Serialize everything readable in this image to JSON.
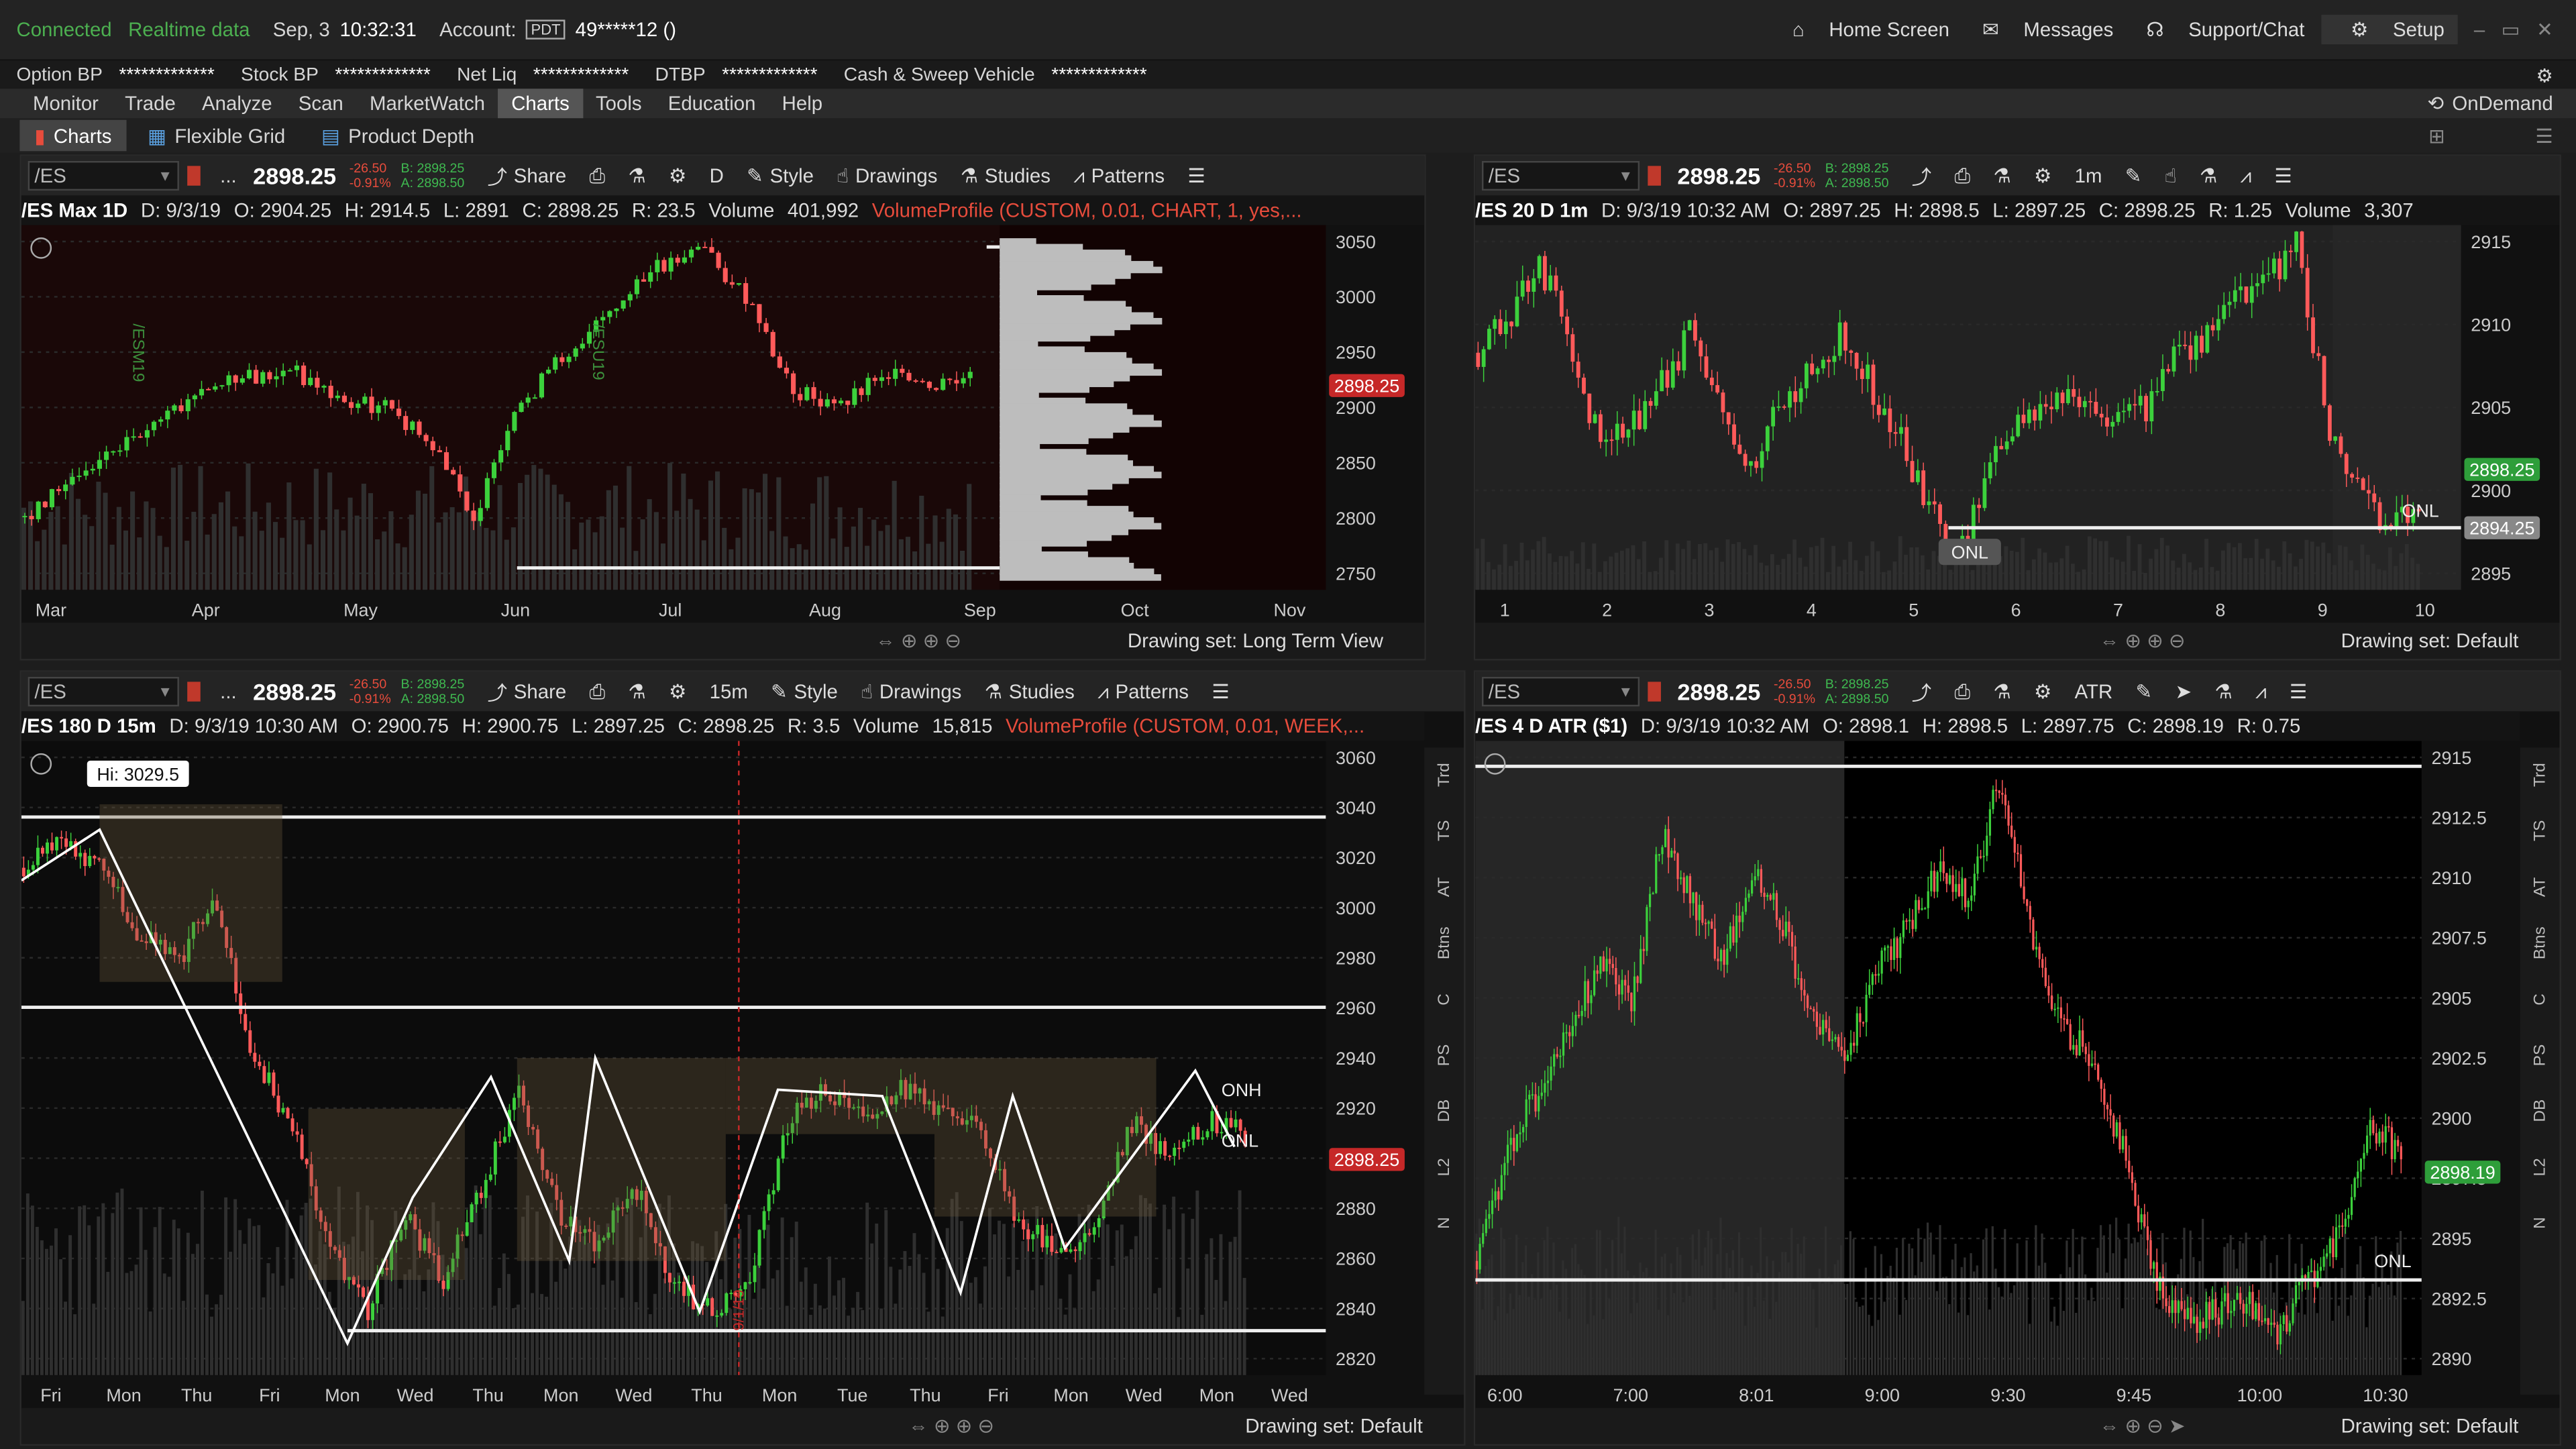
{
  "status": {
    "connected": "Connected",
    "realtime": "Realtime data",
    "date": "Sep, 3",
    "time": "10:32:31",
    "account_label": "Account:",
    "account_tag": "PDT",
    "account_value": "49*****12 ()"
  },
  "topnav": {
    "home": "Home Screen",
    "messages": "Messages",
    "support": "Support/Chat",
    "setup": "Setup"
  },
  "balances": {
    "option_bp": "Option BP",
    "option_bp_val": "*************",
    "stock_bp": "Stock BP",
    "stock_bp_val": "*************",
    "net_liq": "Net Liq",
    "net_liq_val": "*************",
    "dtbp": "DTBP",
    "dtbp_val": "*************",
    "cash": "Cash & Sweep Vehicle",
    "cash_val": "*************"
  },
  "menu": [
    "Monitor",
    "Trade",
    "Analyze",
    "Scan",
    "MarketWatch",
    "Charts",
    "Tools",
    "Education",
    "Help"
  ],
  "ondemand": "OnDemand",
  "subtabs": [
    "Charts",
    "Flexible Grid",
    "Product Depth"
  ],
  "common": {
    "symbol": "/ES",
    "price": "2898.25",
    "chg1": "-26.50",
    "chg2": "-0.91%",
    "bid": "B: 2898.25",
    "ask": "A: 2898.50",
    "share": "Share",
    "style": "Style",
    "drawings": "Drawings",
    "studies": "Studies",
    "patterns": "Patterns",
    "dots": "...",
    "onl": "ONL",
    "onh": "ONH"
  },
  "tl": {
    "agg": "D",
    "info": [
      "/ES Max 1D",
      "D: 9/3/19",
      "O: 2904.25",
      "H: 2914.5",
      "L: 2891",
      "C: 2898.25",
      "R: 23.5",
      "Volume",
      "401,992"
    ],
    "study": "VolumeProfile (CUSTOM, 0.01, CHART, 1, yes,...",
    "footer": "Drawing set: Long Term View",
    "yticks": [
      "3050",
      "3000",
      "2950",
      "2900",
      "2850",
      "2800",
      "2750"
    ],
    "xticks": [
      "Mar",
      "Apr",
      "May",
      "Jun",
      "Jul",
      "Aug",
      "Sep",
      "Oct",
      "Nov"
    ],
    "price_tag": "2898.25",
    "contract1": "/ESM19",
    "contract2": "/ESU19"
  },
  "tr": {
    "agg": "1m",
    "info": [
      "/ES 20 D 1m",
      "D: 9/3/19 10:32 AM",
      "O: 2897.25",
      "H: 2898.5",
      "L: 2897.25",
      "C: 2898.25",
      "R: 1.25",
      "Volume",
      "3,307"
    ],
    "footer": "Drawing set: Default",
    "yticks": [
      "2915",
      "2910",
      "2905",
      "2900",
      "2895"
    ],
    "xticks": [
      "1",
      "2",
      "3",
      "4",
      "5",
      "6",
      "7",
      "8",
      "9",
      "10"
    ],
    "price_tag": "2898.25",
    "onl_tag": "2894.25"
  },
  "bl": {
    "agg": "15m",
    "info": [
      "/ES 180 D 15m",
      "D: 9/3/19 10:30 AM",
      "O: 2900.75",
      "H: 2900.75",
      "L: 2897.25",
      "C: 2898.25",
      "R: 3.5",
      "Volume",
      "15,815"
    ],
    "study": "VolumeProfile (CUSTOM, 0.01, WEEK,...",
    "footer": "Drawing set: Default",
    "hi": "Hi: 3029.5",
    "yticks": [
      "3060",
      "3040",
      "3020",
      "3000",
      "2980",
      "2960",
      "2940",
      "2920",
      "2900",
      "2880",
      "2860",
      "2840",
      "2820"
    ],
    "xticks": [
      "Fri",
      "Mon",
      "Thu",
      "Fri",
      "Mon",
      "Wed",
      "Thu",
      "Mon",
      "Wed",
      "Thu",
      "Mon",
      "Tue",
      "Thu",
      "Fri",
      "Mon",
      "Wed",
      "Mon",
      "Wed"
    ],
    "price_tag": "2898.25",
    "side": [
      "Trd",
      "TS",
      "AT",
      "Btns",
      "C",
      "PS",
      "DB",
      "L2",
      "N"
    ],
    "date_mark": "9/1/19"
  },
  "br": {
    "agg": "ATR",
    "info": [
      "/ES 4 D ATR ($1)",
      "D: 9/3/19 10:32 AM",
      "O: 2898.1",
      "H: 2898.5",
      "L: 2897.75",
      "C: 2898.19",
      "R: 0.75"
    ],
    "footer": "Drawing set: Default",
    "yticks": [
      "2915",
      "2912.5",
      "2910",
      "2907.5",
      "2905",
      "2902.5",
      "2900",
      "2897.5",
      "2895",
      "2892.5",
      "2890"
    ],
    "xticks": [
      "6:00",
      "7:00",
      "8:01",
      "9:00",
      "9:30",
      "9:45",
      "10:00",
      "10:30"
    ],
    "price_tag": "2898.19"
  }
}
